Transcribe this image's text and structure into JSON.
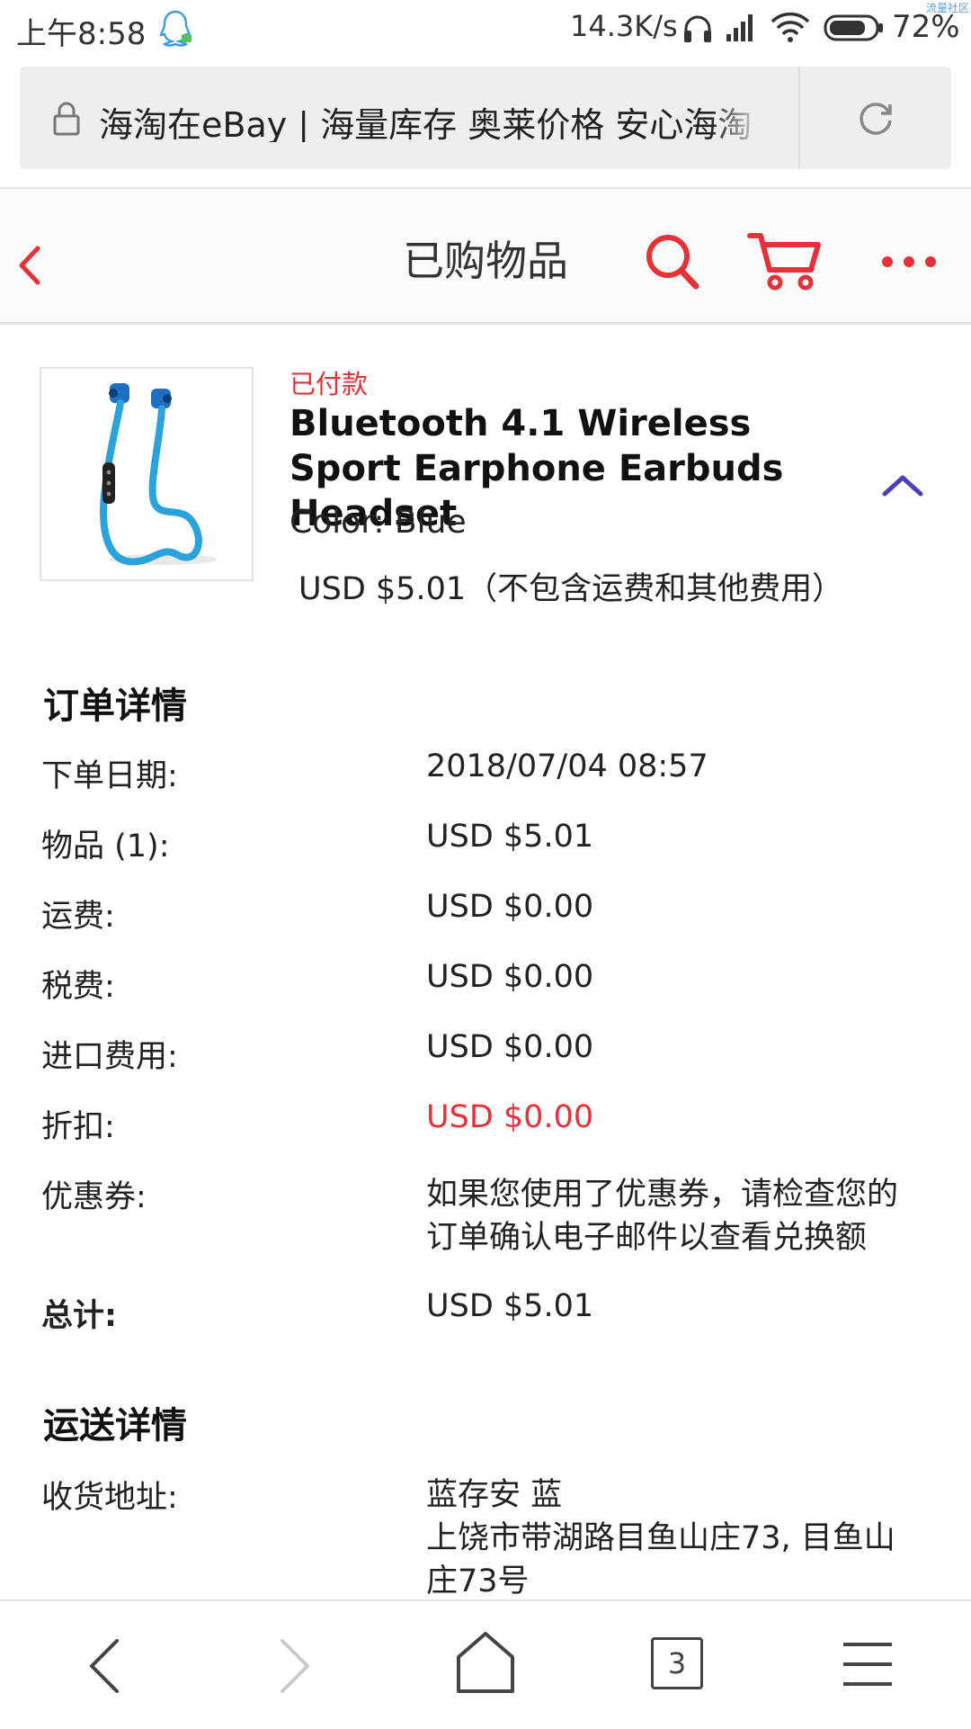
{
  "status_bar": {
    "time": "上午8:58",
    "network_speed": "14.3K/s",
    "battery": "72%",
    "watermark": "流量社区",
    "icons": [
      "qq-icon",
      "headphone-icon",
      "signal-icon",
      "wifi-icon",
      "battery-icon"
    ]
  },
  "browser": {
    "url_text": "海淘在eBay | 海量库存 奥莱价格 安心海淘",
    "tab_count": "3"
  },
  "header": {
    "title": "已购物品"
  },
  "product": {
    "status": "已付款",
    "title": "Bluetooth 4.1 Wireless Sport Earphone Earbuds Headset",
    "variant": "Color: Blue",
    "price": "USD $5.01（不包含运费和其他费用）"
  },
  "order_details": {
    "title": "订单详情",
    "rows": [
      {
        "label": "下单日期:",
        "value": "2018/07/04 08:57"
      },
      {
        "label": "物品 (1):",
        "value": "USD $5.01"
      },
      {
        "label": "运费:",
        "value": "USD $0.00"
      },
      {
        "label": "税费:",
        "value": "USD $0.00"
      },
      {
        "label": "进口费用:",
        "value": "USD $0.00"
      },
      {
        "label": "折扣:",
        "value": "USD $0.00"
      },
      {
        "label": "优惠券:",
        "value": "如果您使用了优惠券，请检查您的订单确认电子邮件以查看兑换额"
      },
      {
        "label": "总计:",
        "value": "USD $5.01"
      }
    ]
  },
  "shipping_details": {
    "title": "运送详情",
    "address_label": "收货地址:",
    "address_name": "蓝存安 蓝",
    "address_line": "上饶市带湖路目鱼山庄73, 目鱼山庄73号"
  },
  "colors": {
    "accent_red": "#e53238",
    "accent_purple": "#4b3fb5",
    "discount_red": "#e53238",
    "earbud_blue": "#2aa3dd"
  }
}
